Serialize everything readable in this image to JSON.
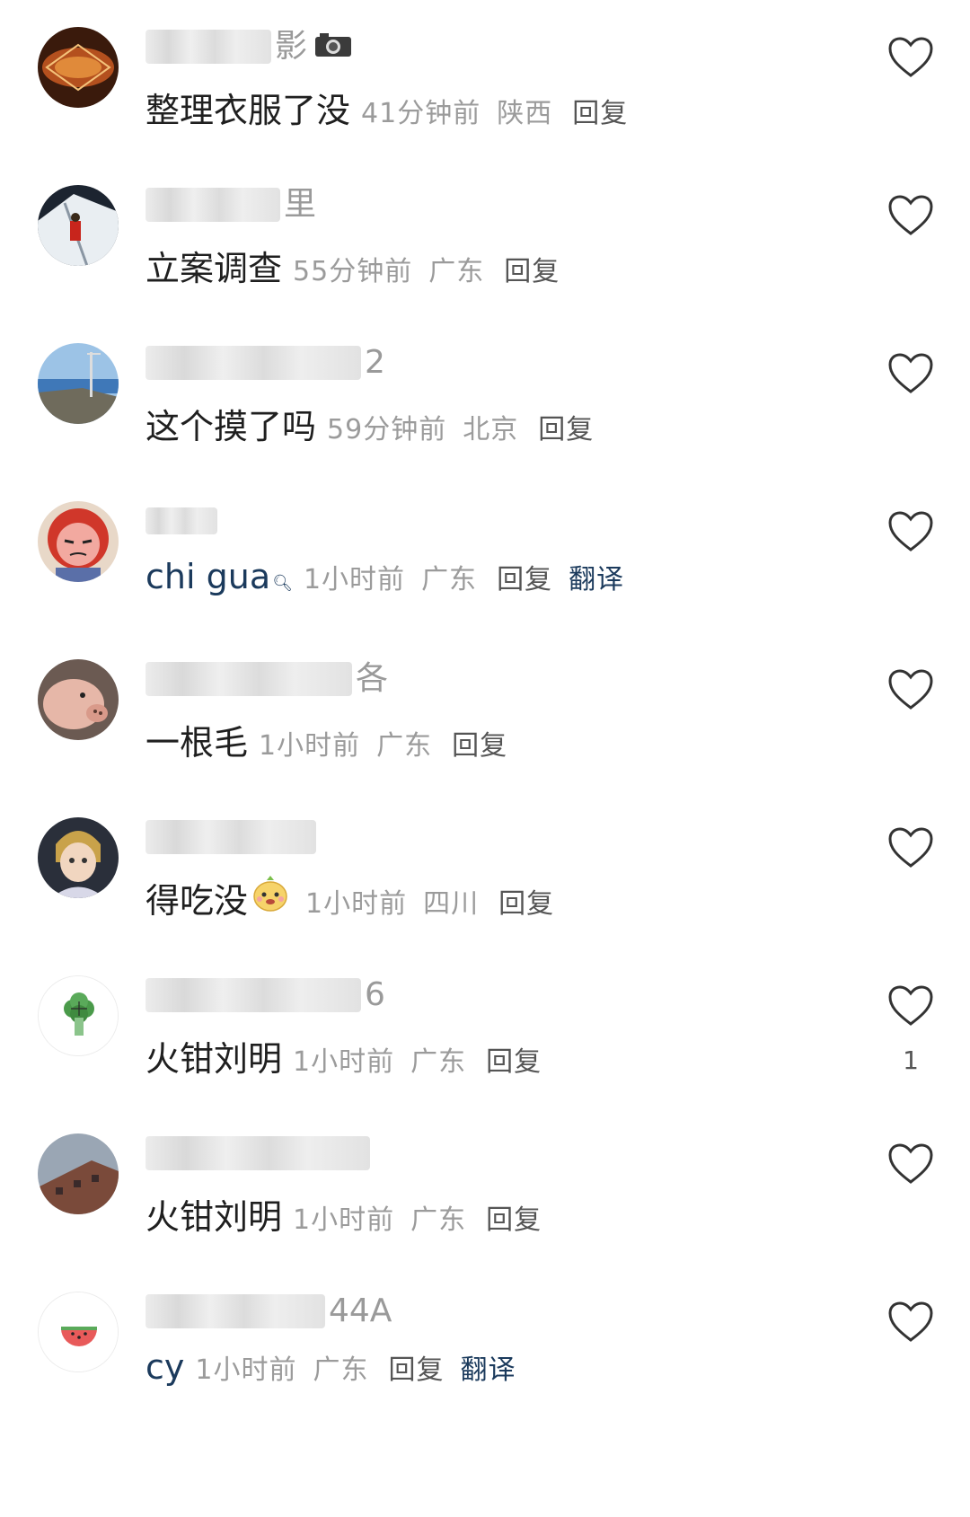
{
  "comments": [
    {
      "name_suffix": "影",
      "name_emoji": "camera-icon",
      "content": "整理衣服了没",
      "time": "41分钟前",
      "location": "陕西",
      "reply_label": "回复"
    },
    {
      "name_suffix": "里",
      "content": "立案调查",
      "time": "55分钟前",
      "location": "广东",
      "reply_label": "回复"
    },
    {
      "name_suffix": "2",
      "content": "这个摸了吗",
      "time": "59分钟前",
      "location": "北京",
      "reply_label": "回复"
    },
    {
      "name_suffix": "",
      "content": "chi gua",
      "time": "1小时前",
      "location": "广东",
      "reply_label": "回复",
      "translate_label": "翻译"
    },
    {
      "name_suffix": "各",
      "content": "一根毛",
      "time": "1小时前",
      "location": "广东",
      "reply_label": "回复"
    },
    {
      "name_suffix": "",
      "content": "得吃没",
      "content_emoji": "face-emoji-icon",
      "time": "1小时前",
      "location": "四川",
      "reply_label": "回复"
    },
    {
      "name_suffix": "6",
      "content": "火钳刘明",
      "time": "1小时前",
      "location": "广东",
      "reply_label": "回复",
      "like_count": "1"
    },
    {
      "name_suffix": "",
      "content": "火钳刘明",
      "time": "1小时前",
      "location": "广东",
      "reply_label": "回复"
    },
    {
      "name_suffix": "44A",
      "content": "cy",
      "time": "1小时前",
      "location": "广东",
      "reply_label": "回复",
      "translate_label": "翻译"
    }
  ],
  "colors": {
    "meta_gray": "#9b9b9b",
    "translate_blue": "#1b3a5c",
    "heart_stroke": "#333333"
  }
}
